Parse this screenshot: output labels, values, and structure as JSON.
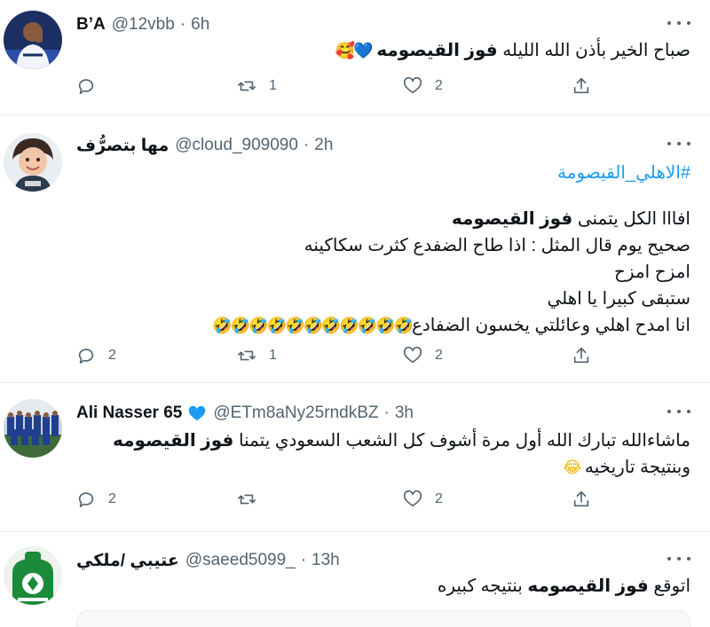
{
  "tweets": [
    {
      "name": "B’A",
      "handle": "@12vbb",
      "time": "6h",
      "verified": false,
      "lines": [
        {
          "before": "صباح الخير بأذن الله الليله ",
          "bold": "فوز القيصومه",
          "after": " "
        }
      ],
      "emoji_tail": "💙🥰",
      "reply_count": "",
      "retweet_count": "1",
      "like_count": "2",
      "avatar": "player-photo-blue"
    },
    {
      "name": "مها بتصرُّف",
      "handle": "@cloud_909090",
      "time": "2h",
      "verified": false,
      "hashtag": "#الاهلي_القيصومة",
      "lines": [
        {
          "before": "افااا الكل يتمنى ",
          "bold": "فوز القيصومه",
          "after": ""
        },
        {
          "before": "صحيح يوم قال المثل : اذا طاح الضفدع كثرت سكاكينه",
          "bold": "",
          "after": ""
        },
        {
          "before": "امزح امزح",
          "bold": "",
          "after": ""
        },
        {
          "before": "ستبقى كبيرا يا اهلي",
          "bold": "",
          "after": ""
        },
        {
          "before": "انا امدح اهلي وعائلتي يخسون الضفادع",
          "bold": "",
          "after": ""
        }
      ],
      "emoji_tail": "🤣🤣🤣🤣🤣🤣🤣🤣🤣🤣🤣",
      "reply_count": "2",
      "retweet_count": "1",
      "like_count": "2",
      "avatar": "child-photo"
    },
    {
      "name": "Ali Nasser 65",
      "handle": "@ETm8aNy25rndkBZ",
      "time": "3h",
      "verified": true,
      "lines": [
        {
          "before": "ماشاءالله تبارك الله أول مرة أشوف كل الشعب السعودي يتمنا ",
          "bold": "فوز القيصومه",
          "after": ""
        },
        {
          "before": "وبنتيجة تاريخيه ",
          "bold": "",
          "after": ""
        }
      ],
      "emoji_tail": "😂",
      "reply_count": "2",
      "retweet_count": "",
      "like_count": "2",
      "avatar": "team-photo"
    },
    {
      "name": "عتيبي /ملكي",
      "handle": "@saeed5099_",
      "time": "13h",
      "verified": false,
      "lines": [
        {
          "before": "اتوقع ",
          "bold": "فوز القيصومه",
          "after": " بنتيجه كبيره"
        }
      ],
      "emoji_tail": "",
      "avatar": "club-logo-green"
    }
  ],
  "colors": {
    "link": "#1d9bf0",
    "secondary_text": "#536471",
    "verified": "#1d9bf0",
    "divider": "#e6ecf0"
  }
}
